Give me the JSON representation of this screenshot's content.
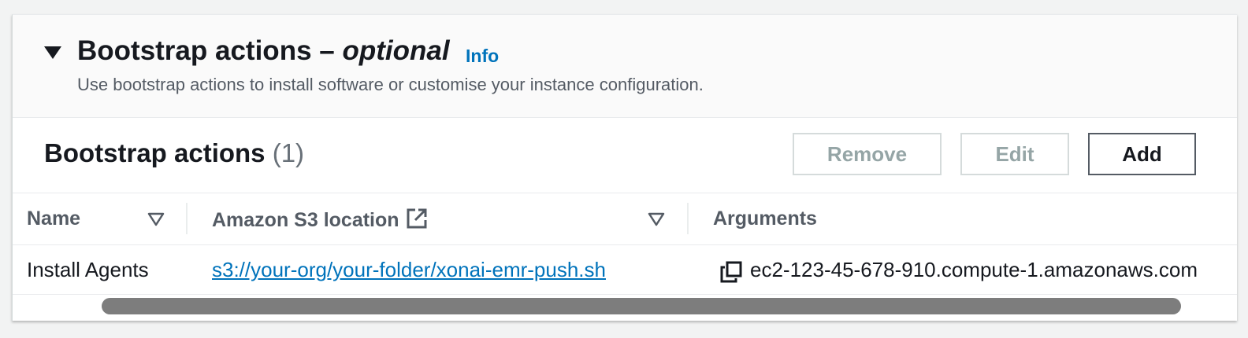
{
  "section": {
    "title_main": "Bootstrap actions – ",
    "title_optional": "optional",
    "info_label": "Info",
    "description": "Use bootstrap actions to install software or customise your instance configuration.",
    "expanded": true
  },
  "table": {
    "title": "Bootstrap actions",
    "count": "(1)",
    "buttons": {
      "remove": "Remove",
      "edit": "Edit",
      "add": "Add"
    },
    "columns": {
      "name": "Name",
      "location": "Amazon S3 location",
      "arguments": "Arguments"
    },
    "rows": [
      {
        "name": "Install Agents",
        "location": "s3://your-org/your-folder/xonai-emr-push.sh",
        "arguments": "ec2-123-45-678-910.compute-1.amazonaws.com"
      }
    ]
  },
  "icons": {
    "expand": "caret-down-icon",
    "sort": "sort-down-icon",
    "external": "external-link-icon",
    "copy": "copy-icon"
  },
  "colors": {
    "link": "#0073bb",
    "text": "#16191f",
    "muted": "#545b64",
    "disabled": "#95a5a6",
    "scrollbar": "#7d7d7d"
  }
}
